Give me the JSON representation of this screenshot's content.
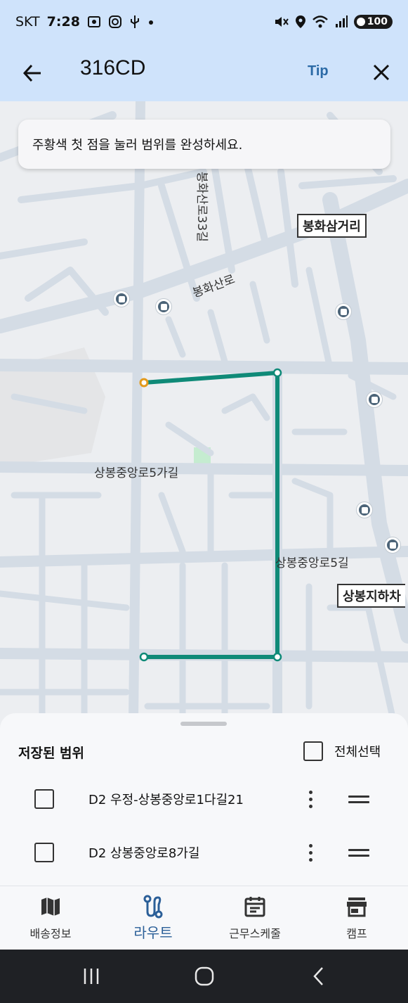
{
  "status_bar": {
    "carrier": "SKT",
    "time": "7:28",
    "battery": "100"
  },
  "app_bar": {
    "title": "316CD",
    "tip_label": "Tip"
  },
  "map": {
    "toast": "주황색 첫 점을 눌러 범위를 완성하세요.",
    "labels": {
      "bonghwa_33": "봉화산로33길",
      "bonghwa_ro": "봉화산로",
      "sangbong_5ga": "상봉중앙로5가길",
      "sangbong_5gil": "상봉중앙로5길",
      "bonghwa_samgeori": "봉화삼거리",
      "sangbong_station": "상봉지하차"
    },
    "route_color": "#0f8a78",
    "start_point_color": "#e39a1b"
  },
  "sheet": {
    "title": "저장된 범위",
    "select_all_label": "전체선택",
    "ranges": [
      {
        "label": "D2 우정-상봉중앙로1다길21"
      },
      {
        "label": "D2 상봉중앙로8가길"
      }
    ]
  },
  "bottom_nav": {
    "items": [
      {
        "label": "배송정보",
        "icon": "map-icon"
      },
      {
        "label": "라우트",
        "icon": "route-icon",
        "active": true
      },
      {
        "label": "근무스케줄",
        "icon": "calendar-icon"
      },
      {
        "label": "캠프",
        "icon": "store-icon"
      }
    ],
    "active_color": "#2b5f98"
  }
}
